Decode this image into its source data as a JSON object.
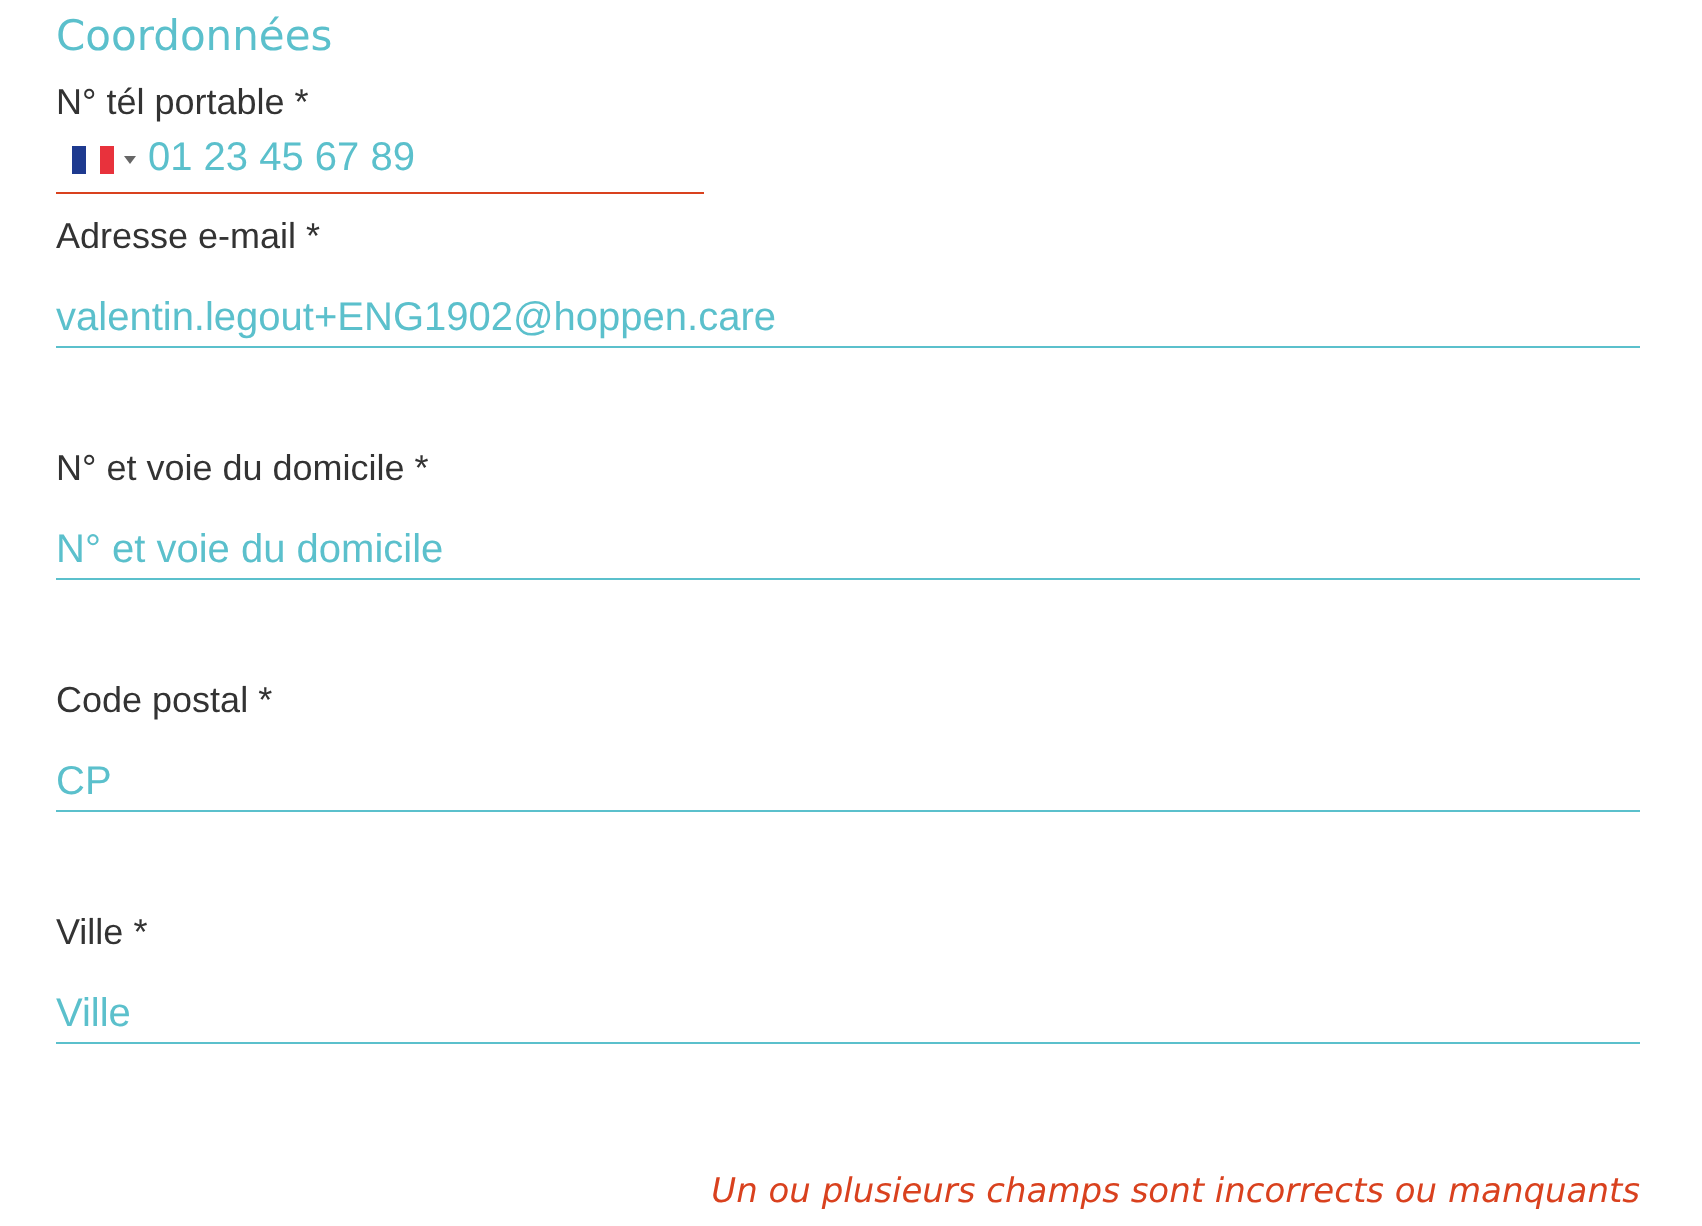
{
  "section_title": "Coordonnées",
  "fields": [
    {
      "kind": "phone",
      "label": "N° tél portable *",
      "placeholder": "01 23 45 67 89",
      "invalid": true
    },
    {
      "kind": "text",
      "label": "Adresse e-mail *",
      "value": "valentin.legout+ENG1902@hoppen.care",
      "invalid": false
    },
    {
      "kind": "text",
      "label": "N° et voie du domicile *",
      "placeholder": "N° et voie du domicile",
      "invalid": false
    },
    {
      "kind": "text",
      "label": "Code postal *",
      "placeholder": "CP",
      "invalid": false
    },
    {
      "kind": "text",
      "label": "Ville *",
      "placeholder": "Ville",
      "invalid": false
    }
  ],
  "error_message": "Un ou plusieurs champs sont incorrects ou manquants"
}
